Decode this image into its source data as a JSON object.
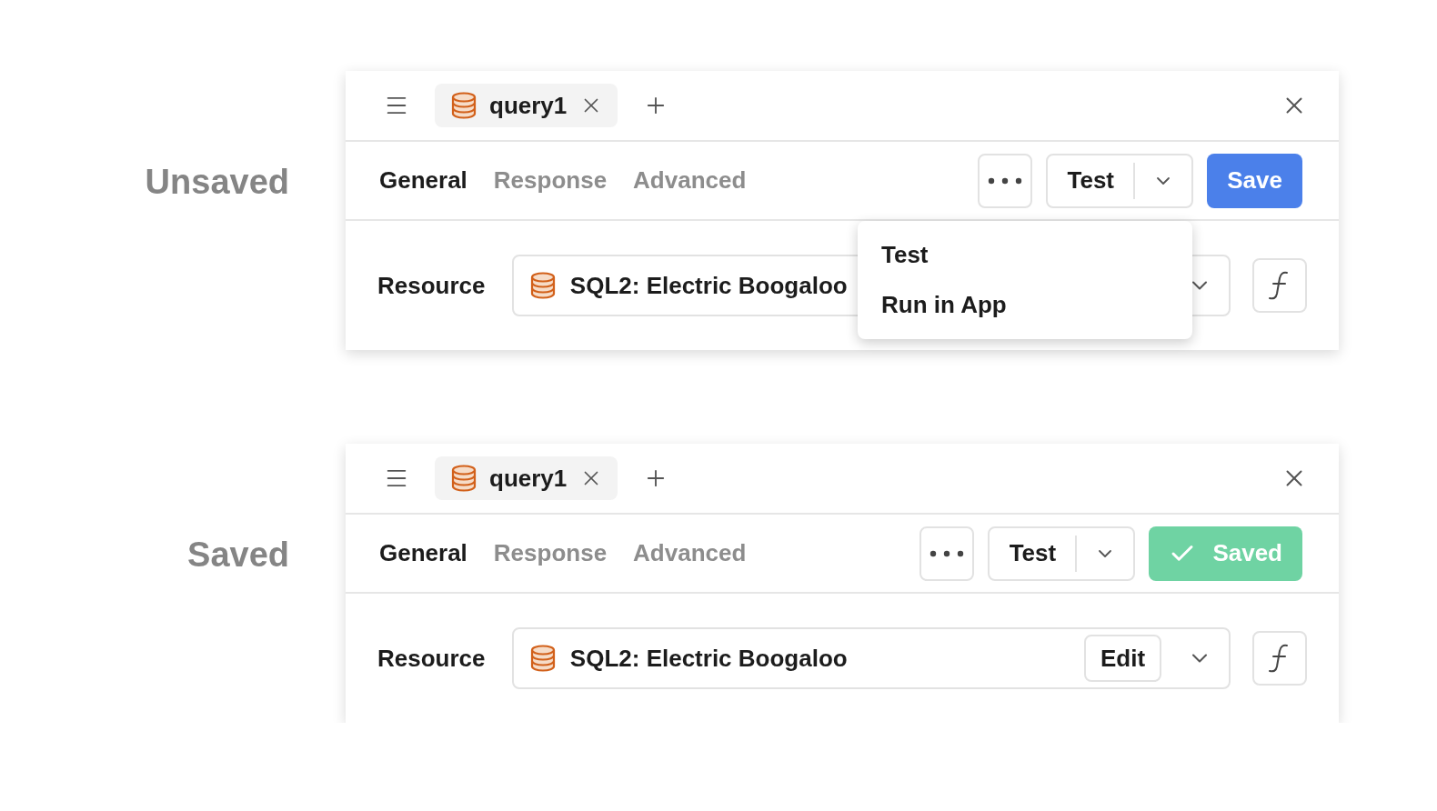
{
  "panels": [
    {
      "label": "Unsaved",
      "tab": "query1",
      "sections": [
        {
          "label": "General",
          "selected": true
        },
        {
          "label": "Response",
          "selected": false
        },
        {
          "label": "Advanced",
          "selected": false
        }
      ],
      "test_label": "Test",
      "status": {
        "kind": "save",
        "label": "Save"
      },
      "resource_label": "Resource",
      "resource": "SQL2: Electric Boogaloo",
      "menu": [
        "Test",
        "Run in App"
      ]
    },
    {
      "label": "Saved",
      "tab": "query1",
      "sections": [
        {
          "label": "General",
          "selected": true
        },
        {
          "label": "Response",
          "selected": false
        },
        {
          "label": "Advanced",
          "selected": false
        }
      ],
      "test_label": "Test",
      "status": {
        "kind": "saved",
        "label": "Saved"
      },
      "resource_label": "Resource",
      "resource": "SQL2: Electric Boogaloo",
      "edit_label": "Edit"
    }
  ]
}
